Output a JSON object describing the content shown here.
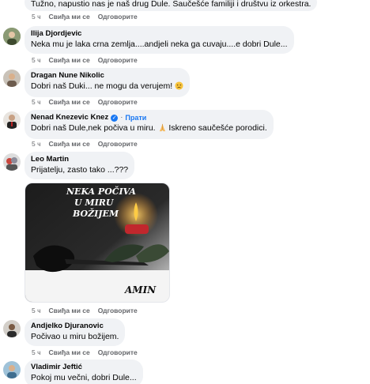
{
  "comments": [
    {
      "author": "",
      "text": "Tužno, napustio nas je naš drug Dule. Saučešće familiji i društvu iz orkestra.",
      "time": "5 ч",
      "like": "Свиђа ми се",
      "reply": "Одговорите"
    },
    {
      "author": "Ilija Djordjevic",
      "text": "Neka mu je laka crna zemlja....andjeli neka ga cuvaju....e dobri Dule...",
      "time": "5 ч",
      "like": "Свиђа ми се",
      "reply": "Одговорите"
    },
    {
      "author": "Dragan Nune Nikolic",
      "text": "Dobri naš Duki... ne mogu da verujem!",
      "time": "5 ч",
      "like": "Свиђа ми се",
      "reply": "Одговорите"
    },
    {
      "author": "Nenad Knezevic Knez",
      "follow": "Прати",
      "text": "Dobri naš Dule,nek počiva u miru.",
      "text2": "Iskreno saučešće porodici.",
      "time": "5 ч",
      "like": "Свиђа ми се",
      "reply": "Одговорите"
    },
    {
      "author": "Leo Martin",
      "text": "Prijatelju, zasto tako ...???",
      "time": "5 ч",
      "like": "Свиђа ми се",
      "reply": "Одговорите"
    },
    {
      "author": "Andjelko Djuranovic",
      "text": "Počivao u miru božijem.",
      "time": "5 ч",
      "like": "Свиђа ми се",
      "reply": "Одговорите"
    },
    {
      "author": "Vladimir Jeftić",
      "text": "Pokoj mu večni, dobri Dule...",
      "time": "",
      "like": "",
      "reply": ""
    }
  ],
  "photo": {
    "line1": "NEKA POČIVA",
    "line2": "U MIRU",
    "line3": "BOŽIJEM",
    "footer": "AMIN",
    "time": "5 ч",
    "like": "Свиђа ми се",
    "reply": "Одговорите"
  },
  "icons": {
    "verified": "verified-badge-icon",
    "sad": "sad-emoji-icon",
    "pray": "praying-hands-icon",
    "candle": "candle-icon",
    "rose": "rose-icon"
  },
  "colors": {
    "bubble": "#f0f2f5",
    "meta": "#65676b",
    "link": "#1877f2"
  }
}
